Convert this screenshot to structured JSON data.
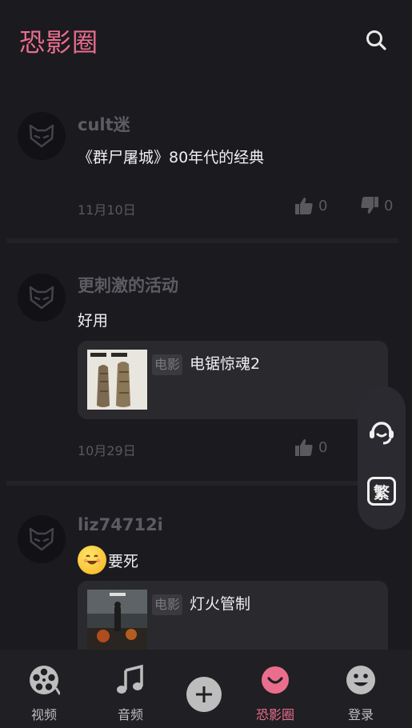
{
  "header": {
    "title": "恐影圈"
  },
  "posts": [
    {
      "username": "cult迷",
      "content": "《群尸屠城》80年代的经典",
      "date": "11月10日",
      "likes": "0",
      "dislikes": "0"
    },
    {
      "username": "更刺激的活动",
      "content": "好用",
      "movie": {
        "badge": "电影",
        "title": "电锯惊魂2"
      },
      "date": "10月29日",
      "likes": "0",
      "dislikes": "0"
    },
    {
      "username": "liz74712i",
      "content": "要死",
      "movie": {
        "badge": "电影",
        "title": "灯火管制"
      }
    }
  ],
  "float_panel": {
    "translate_label": "繁"
  },
  "tabs": [
    {
      "label": "视频",
      "icon": "film-reel-icon"
    },
    {
      "label": "音频",
      "icon": "music-note-icon"
    },
    {
      "label": "",
      "icon": "add-icon"
    },
    {
      "label": "恐影圈",
      "icon": "chat-bubble-icon",
      "active": true
    },
    {
      "label": "登录",
      "icon": "smiley-face-icon"
    }
  ],
  "colors": {
    "accent": "#e96e8d",
    "background": "#1b1a1f",
    "tabbar": "#201f24"
  }
}
